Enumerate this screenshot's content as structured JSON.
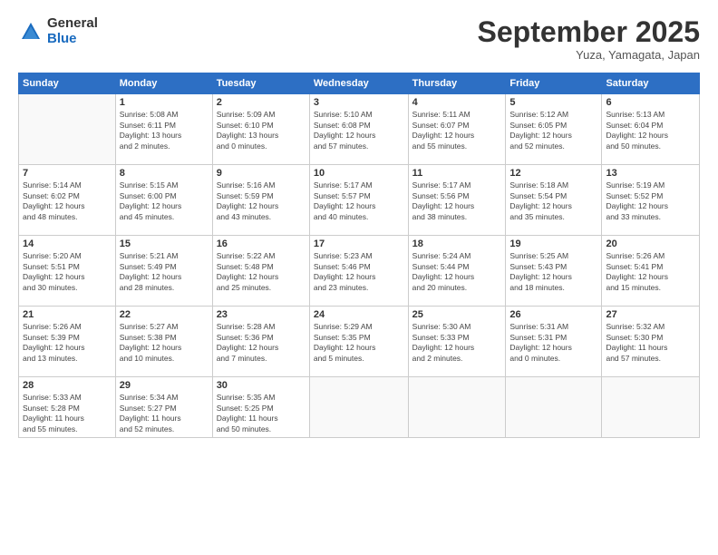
{
  "logo": {
    "general": "General",
    "blue": "Blue"
  },
  "title": "September 2025",
  "subtitle": "Yuza, Yamagata, Japan",
  "days_header": [
    "Sunday",
    "Monday",
    "Tuesday",
    "Wednesday",
    "Thursday",
    "Friday",
    "Saturday"
  ],
  "weeks": [
    [
      {
        "num": "",
        "info": ""
      },
      {
        "num": "1",
        "info": "Sunrise: 5:08 AM\nSunset: 6:11 PM\nDaylight: 13 hours\nand 2 minutes."
      },
      {
        "num": "2",
        "info": "Sunrise: 5:09 AM\nSunset: 6:10 PM\nDaylight: 13 hours\nand 0 minutes."
      },
      {
        "num": "3",
        "info": "Sunrise: 5:10 AM\nSunset: 6:08 PM\nDaylight: 12 hours\nand 57 minutes."
      },
      {
        "num": "4",
        "info": "Sunrise: 5:11 AM\nSunset: 6:07 PM\nDaylight: 12 hours\nand 55 minutes."
      },
      {
        "num": "5",
        "info": "Sunrise: 5:12 AM\nSunset: 6:05 PM\nDaylight: 12 hours\nand 52 minutes."
      },
      {
        "num": "6",
        "info": "Sunrise: 5:13 AM\nSunset: 6:04 PM\nDaylight: 12 hours\nand 50 minutes."
      }
    ],
    [
      {
        "num": "7",
        "info": "Sunrise: 5:14 AM\nSunset: 6:02 PM\nDaylight: 12 hours\nand 48 minutes."
      },
      {
        "num": "8",
        "info": "Sunrise: 5:15 AM\nSunset: 6:00 PM\nDaylight: 12 hours\nand 45 minutes."
      },
      {
        "num": "9",
        "info": "Sunrise: 5:16 AM\nSunset: 5:59 PM\nDaylight: 12 hours\nand 43 minutes."
      },
      {
        "num": "10",
        "info": "Sunrise: 5:17 AM\nSunset: 5:57 PM\nDaylight: 12 hours\nand 40 minutes."
      },
      {
        "num": "11",
        "info": "Sunrise: 5:17 AM\nSunset: 5:56 PM\nDaylight: 12 hours\nand 38 minutes."
      },
      {
        "num": "12",
        "info": "Sunrise: 5:18 AM\nSunset: 5:54 PM\nDaylight: 12 hours\nand 35 minutes."
      },
      {
        "num": "13",
        "info": "Sunrise: 5:19 AM\nSunset: 5:52 PM\nDaylight: 12 hours\nand 33 minutes."
      }
    ],
    [
      {
        "num": "14",
        "info": "Sunrise: 5:20 AM\nSunset: 5:51 PM\nDaylight: 12 hours\nand 30 minutes."
      },
      {
        "num": "15",
        "info": "Sunrise: 5:21 AM\nSunset: 5:49 PM\nDaylight: 12 hours\nand 28 minutes."
      },
      {
        "num": "16",
        "info": "Sunrise: 5:22 AM\nSunset: 5:48 PM\nDaylight: 12 hours\nand 25 minutes."
      },
      {
        "num": "17",
        "info": "Sunrise: 5:23 AM\nSunset: 5:46 PM\nDaylight: 12 hours\nand 23 minutes."
      },
      {
        "num": "18",
        "info": "Sunrise: 5:24 AM\nSunset: 5:44 PM\nDaylight: 12 hours\nand 20 minutes."
      },
      {
        "num": "19",
        "info": "Sunrise: 5:25 AM\nSunset: 5:43 PM\nDaylight: 12 hours\nand 18 minutes."
      },
      {
        "num": "20",
        "info": "Sunrise: 5:26 AM\nSunset: 5:41 PM\nDaylight: 12 hours\nand 15 minutes."
      }
    ],
    [
      {
        "num": "21",
        "info": "Sunrise: 5:26 AM\nSunset: 5:39 PM\nDaylight: 12 hours\nand 13 minutes."
      },
      {
        "num": "22",
        "info": "Sunrise: 5:27 AM\nSunset: 5:38 PM\nDaylight: 12 hours\nand 10 minutes."
      },
      {
        "num": "23",
        "info": "Sunrise: 5:28 AM\nSunset: 5:36 PM\nDaylight: 12 hours\nand 7 minutes."
      },
      {
        "num": "24",
        "info": "Sunrise: 5:29 AM\nSunset: 5:35 PM\nDaylight: 12 hours\nand 5 minutes."
      },
      {
        "num": "25",
        "info": "Sunrise: 5:30 AM\nSunset: 5:33 PM\nDaylight: 12 hours\nand 2 minutes."
      },
      {
        "num": "26",
        "info": "Sunrise: 5:31 AM\nSunset: 5:31 PM\nDaylight: 12 hours\nand 0 minutes."
      },
      {
        "num": "27",
        "info": "Sunrise: 5:32 AM\nSunset: 5:30 PM\nDaylight: 11 hours\nand 57 minutes."
      }
    ],
    [
      {
        "num": "28",
        "info": "Sunrise: 5:33 AM\nSunset: 5:28 PM\nDaylight: 11 hours\nand 55 minutes."
      },
      {
        "num": "29",
        "info": "Sunrise: 5:34 AM\nSunset: 5:27 PM\nDaylight: 11 hours\nand 52 minutes."
      },
      {
        "num": "30",
        "info": "Sunrise: 5:35 AM\nSunset: 5:25 PM\nDaylight: 11 hours\nand 50 minutes."
      },
      {
        "num": "",
        "info": ""
      },
      {
        "num": "",
        "info": ""
      },
      {
        "num": "",
        "info": ""
      },
      {
        "num": "",
        "info": ""
      }
    ]
  ]
}
